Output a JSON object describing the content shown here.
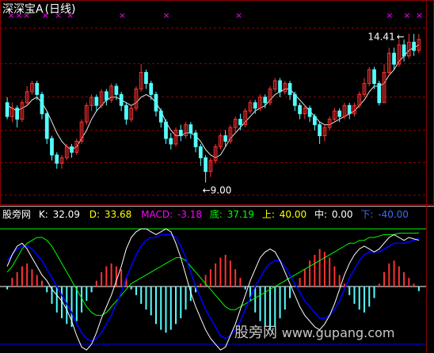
{
  "header": {
    "title": "深深宝A",
    "period": "(日线)"
  },
  "colors": {
    "up": "#ff3232",
    "down": "#54ffff",
    "grid": "#8b0000",
    "ma": "#e8e8e8",
    "marker": "#ff00ff",
    "k": "#ffffff",
    "d": "#ffff00",
    "macd": "#ff00ff",
    "bottom": "#00ff00",
    "upper": "#ffff00",
    "middle": "#ffffff",
    "lower": "#0000ff",
    "frame": "#c0c0c0"
  },
  "price_panel": {
    "high_label": "14.41",
    "low_label": "9.00",
    "high_arrow": "←",
    "low_arrow": "←",
    "marker_glyph": "×"
  },
  "indicator_header": {
    "name": "股旁网",
    "k_label": "K:",
    "k_value": "32.09",
    "d_label": "D:",
    "d_value": "33.68",
    "macd_label": "MACD:",
    "macd_value": "-3.18",
    "bottom_label": "底:",
    "bottom_value": "37.19",
    "upper_label": "上:",
    "upper_value": "40.00",
    "middle_label": "中:",
    "middle_value": "0.00",
    "lower_label": "下:",
    "lower_value": "-40.00"
  },
  "watermark": {
    "text": "股旁网",
    "url": "www.gupang.com"
  },
  "chart_data": [
    {
      "type": "candlestick",
      "series_name": "深深宝A",
      "ylim": [
        8.5,
        15.0
      ],
      "high_mark": 14.41,
      "low_mark": 9.0,
      "candles": [
        [
          0,
          11.9,
          11.4,
          12.1,
          11.3
        ],
        [
          1,
          11.4,
          11.7,
          11.9,
          11.2
        ],
        [
          2,
          11.7,
          11.3,
          11.8,
          11.0
        ],
        [
          3,
          11.3,
          11.9,
          12.0,
          11.2
        ],
        [
          4,
          11.9,
          12.3,
          12.5,
          11.8
        ],
        [
          5,
          12.3,
          12.6,
          12.7,
          12.2
        ],
        [
          6,
          12.6,
          12.2,
          12.7,
          12.0
        ],
        [
          7,
          12.2,
          11.5,
          12.3,
          11.3
        ],
        [
          8,
          11.5,
          10.6,
          11.6,
          10.4
        ],
        [
          9,
          10.6,
          10.0,
          10.7,
          9.8
        ],
        [
          10,
          10.0,
          9.7,
          10.1,
          9.5
        ],
        [
          11,
          9.7,
          9.9,
          10.0,
          9.5
        ],
        [
          12,
          9.9,
          10.3,
          10.4,
          9.8
        ],
        [
          13,
          10.3,
          10.1,
          10.4,
          9.9
        ],
        [
          14,
          10.1,
          10.5,
          10.6,
          10.0
        ],
        [
          15,
          10.5,
          11.2,
          11.3,
          10.4
        ],
        [
          16,
          11.2,
          11.8,
          11.9,
          11.1
        ],
        [
          17,
          11.8,
          12.1,
          12.2,
          11.6
        ],
        [
          18,
          12.1,
          11.8,
          12.2,
          11.6
        ],
        [
          19,
          11.8,
          12.3,
          12.4,
          11.7
        ],
        [
          20,
          12.3,
          12.0,
          12.4,
          11.8
        ],
        [
          21,
          12.0,
          12.5,
          12.6,
          11.9
        ],
        [
          22,
          12.5,
          12.2,
          12.6,
          12.0
        ],
        [
          23,
          12.2,
          11.8,
          12.3,
          11.6
        ],
        [
          24,
          11.8,
          11.3,
          11.9,
          11.1
        ],
        [
          25,
          11.3,
          11.7,
          11.8,
          11.2
        ],
        [
          26,
          11.7,
          12.4,
          12.5,
          11.6
        ],
        [
          27,
          12.4,
          13.0,
          13.3,
          12.3
        ],
        [
          28,
          13.0,
          12.6,
          13.1,
          12.4
        ],
        [
          29,
          12.6,
          12.2,
          12.7,
          12.0
        ],
        [
          30,
          12.2,
          11.6,
          12.3,
          11.4
        ],
        [
          31,
          11.6,
          11.2,
          11.7,
          11.0
        ],
        [
          32,
          11.2,
          10.6,
          11.3,
          10.4
        ],
        [
          33,
          10.6,
          10.4,
          10.8,
          10.2
        ],
        [
          34,
          10.4,
          10.9,
          11.0,
          10.3
        ],
        [
          35,
          10.9,
          10.7,
          11.1,
          10.5
        ],
        [
          36,
          10.7,
          11.1,
          11.2,
          10.6
        ],
        [
          37,
          11.1,
          10.8,
          11.2,
          10.6
        ],
        [
          38,
          10.8,
          10.3,
          10.9,
          10.1
        ],
        [
          39,
          10.3,
          9.9,
          10.4,
          9.6
        ],
        [
          40,
          9.9,
          9.4,
          10.0,
          9.0
        ],
        [
          41,
          9.4,
          9.8,
          9.9,
          9.2
        ],
        [
          42,
          9.8,
          10.3,
          10.4,
          9.7
        ],
        [
          43,
          10.3,
          10.7,
          10.8,
          10.2
        ],
        [
          44,
          10.7,
          10.5,
          10.9,
          10.3
        ],
        [
          45,
          10.5,
          11.0,
          11.1,
          10.4
        ],
        [
          46,
          11.0,
          11.3,
          11.4,
          10.8
        ],
        [
          47,
          11.3,
          11.1,
          11.5,
          10.9
        ],
        [
          48,
          11.1,
          11.6,
          11.7,
          11.0
        ],
        [
          49,
          11.6,
          11.9,
          12.0,
          11.5
        ],
        [
          50,
          11.9,
          11.7,
          12.0,
          11.5
        ],
        [
          51,
          11.7,
          12.1,
          12.2,
          11.6
        ],
        [
          52,
          12.1,
          11.9,
          12.2,
          11.7
        ],
        [
          53,
          11.9,
          12.4,
          12.5,
          11.8
        ],
        [
          54,
          12.4,
          12.7,
          12.8,
          12.3
        ],
        [
          55,
          12.7,
          12.3,
          12.8,
          12.1
        ],
        [
          56,
          12.3,
          12.6,
          12.7,
          12.2
        ],
        [
          57,
          12.6,
          12.2,
          12.7,
          12.0
        ],
        [
          58,
          12.2,
          11.8,
          12.3,
          11.6
        ],
        [
          59,
          11.8,
          11.5,
          11.9,
          11.3
        ],
        [
          60,
          11.5,
          11.7,
          11.8,
          11.3
        ],
        [
          61,
          11.7,
          11.4,
          11.8,
          11.2
        ],
        [
          62,
          11.4,
          11.1,
          11.5,
          10.9
        ],
        [
          63,
          11.1,
          10.7,
          11.2,
          10.4
        ],
        [
          64,
          10.7,
          11.0,
          11.1,
          10.5
        ],
        [
          65,
          11.0,
          11.3,
          11.4,
          10.9
        ],
        [
          66,
          11.3,
          11.6,
          11.7,
          11.2
        ],
        [
          67,
          11.6,
          11.4,
          11.7,
          11.2
        ],
        [
          68,
          11.4,
          11.8,
          11.9,
          11.3
        ],
        [
          69,
          11.8,
          11.5,
          11.9,
          11.3
        ],
        [
          70,
          11.5,
          11.8,
          11.9,
          11.4
        ],
        [
          71,
          11.8,
          12.2,
          12.3,
          11.7
        ],
        [
          72,
          12.2,
          12.6,
          12.8,
          12.1
        ],
        [
          73,
          12.6,
          13.1,
          13.2,
          12.5
        ],
        [
          74,
          13.1,
          12.6,
          13.2,
          12.4
        ],
        [
          75,
          12.6,
          11.9,
          12.7,
          11.8
        ],
        [
          76,
          11.9,
          13.0,
          13.3,
          11.9
        ],
        [
          77,
          13.0,
          13.7,
          13.9,
          12.9
        ],
        [
          78,
          13.7,
          13.3,
          13.9,
          13.1
        ],
        [
          79,
          13.3,
          14.0,
          14.2,
          13.2
        ],
        [
          80,
          14.0,
          13.6,
          14.2,
          13.4
        ],
        [
          81,
          13.6,
          14.1,
          14.41,
          13.5
        ],
        [
          82,
          14.1,
          13.8,
          14.4,
          13.6
        ],
        [
          83,
          13.8,
          14.2,
          14.4,
          13.7
        ]
      ],
      "ma": [
        11.8,
        11.7,
        11.6,
        11.7,
        11.8,
        12.0,
        12.1,
        11.9,
        11.6,
        11.2,
        10.8,
        10.5,
        10.3,
        10.2,
        10.3,
        10.6,
        10.9,
        11.3,
        11.6,
        11.8,
        12.0,
        12.1,
        12.1,
        12.0,
        11.9,
        11.8,
        11.9,
        12.1,
        12.2,
        12.1,
        11.9,
        11.6,
        11.2,
        10.9,
        10.7,
        10.7,
        10.8,
        10.8,
        10.7,
        10.5,
        10.2,
        10.0,
        9.9,
        10.0,
        10.3,
        10.6,
        10.8,
        11.0,
        11.2,
        11.4,
        11.6,
        11.7,
        11.8,
        12.0,
        12.2,
        12.3,
        12.4,
        12.4,
        12.2,
        12.0,
        11.8,
        11.6,
        11.4,
        11.2,
        11.1,
        11.1,
        11.2,
        11.3,
        11.4,
        11.5,
        11.6,
        11.8,
        12.0,
        12.3,
        12.5,
        12.5,
        12.6,
        12.9,
        13.1,
        13.4,
        13.6,
        13.8,
        13.9,
        14.0
      ],
      "markers_x": [
        0.7,
        2.3,
        3.8,
        7.6,
        10.2,
        12.6,
        23.1,
        32.0,
        46.6,
        77.0,
        80.5,
        83.0
      ]
    },
    {
      "type": "line+bar",
      "series_name": "股旁网",
      "ylim": [
        -45,
        45
      ],
      "reference_lines": {
        "upper": 40.0,
        "middle": 0.0,
        "lower": -40.0
      },
      "k_value": 32.09,
      "d_value": 33.68,
      "macd_value": -3.18,
      "bottom_value": 37.19,
      "macd": [
        -2,
        6,
        10,
        14,
        16,
        12,
        8,
        4,
        -4,
        -12,
        -18,
        -22,
        -26,
        -28,
        -24,
        -18,
        -10,
        -4,
        4,
        10,
        14,
        16,
        14,
        12,
        6,
        -2,
        -6,
        -12,
        -16,
        -20,
        -26,
        -30,
        -32,
        -30,
        -26,
        -22,
        -16,
        -10,
        -4,
        2,
        8,
        12,
        16,
        20,
        22,
        18,
        12,
        6,
        -2,
        -10,
        -18,
        -24,
        -28,
        -30,
        -28,
        -22,
        -16,
        -8,
        0,
        6,
        12,
        18,
        22,
        26,
        24,
        20,
        14,
        8,
        2,
        -6,
        -12,
        -16,
        -18,
        -14,
        -8,
        2,
        10,
        16,
        18,
        14,
        10,
        6,
        2,
        -3.18
      ],
      "k": [
        14,
        22,
        28,
        30,
        26,
        20,
        14,
        8,
        4,
        -2,
        -6,
        -10,
        -16,
        -24,
        -34,
        -42,
        -44,
        -40,
        -32,
        -22,
        -14,
        -6,
        4,
        14,
        26,
        34,
        38,
        40,
        40,
        38,
        36,
        38,
        40,
        38,
        30,
        20,
        8,
        -4,
        -14,
        -22,
        -30,
        -36,
        -40,
        -44,
        -42,
        -34,
        -26,
        -16,
        -6,
        4,
        12,
        20,
        24,
        26,
        24,
        18,
        10,
        2,
        -6,
        -14,
        -20,
        -24,
        -28,
        -30,
        -26,
        -20,
        -12,
        -2,
        8,
        16,
        22,
        26,
        28,
        26,
        24,
        26,
        30,
        34,
        36,
        34,
        32,
        34,
        33,
        32.09
      ],
      "d": [
        18,
        22,
        26,
        28,
        28,
        26,
        22,
        18,
        12,
        6,
        0,
        -6,
        -12,
        -18,
        -26,
        -32,
        -36,
        -38,
        -36,
        -32,
        -26,
        -20,
        -12,
        -4,
        6,
        14,
        22,
        28,
        32,
        34,
        34,
        36,
        36,
        36,
        34,
        28,
        20,
        10,
        0,
        -8,
        -16,
        -22,
        -28,
        -34,
        -36,
        -34,
        -30,
        -24,
        -16,
        -8,
        0,
        6,
        12,
        16,
        18,
        18,
        14,
        8,
        2,
        -4,
        -10,
        -14,
        -18,
        -22,
        -22,
        -20,
        -16,
        -10,
        -2,
        6,
        12,
        18,
        22,
        24,
        24,
        24,
        26,
        28,
        30,
        30,
        30,
        31,
        32,
        33.68
      ],
      "bottom": [
        10,
        14,
        20,
        26,
        30,
        32,
        34,
        34,
        32,
        28,
        22,
        16,
        10,
        4,
        -2,
        -8,
        -14,
        -18,
        -20,
        -20,
        -18,
        -14,
        -10,
        -6,
        -2,
        2,
        4,
        6,
        8,
        10,
        12,
        14,
        16,
        18,
        20,
        20,
        18,
        14,
        10,
        6,
        2,
        -2,
        -6,
        -10,
        -14,
        -16,
        -16,
        -14,
        -12,
        -10,
        -8,
        -6,
        -4,
        -2,
        0,
        2,
        4,
        6,
        8,
        10,
        12,
        14,
        16,
        18,
        20,
        22,
        24,
        26,
        28,
        30,
        30,
        32,
        32,
        34,
        34,
        35,
        36,
        36,
        36,
        37,
        37,
        37,
        37,
        37.19
      ]
    }
  ]
}
